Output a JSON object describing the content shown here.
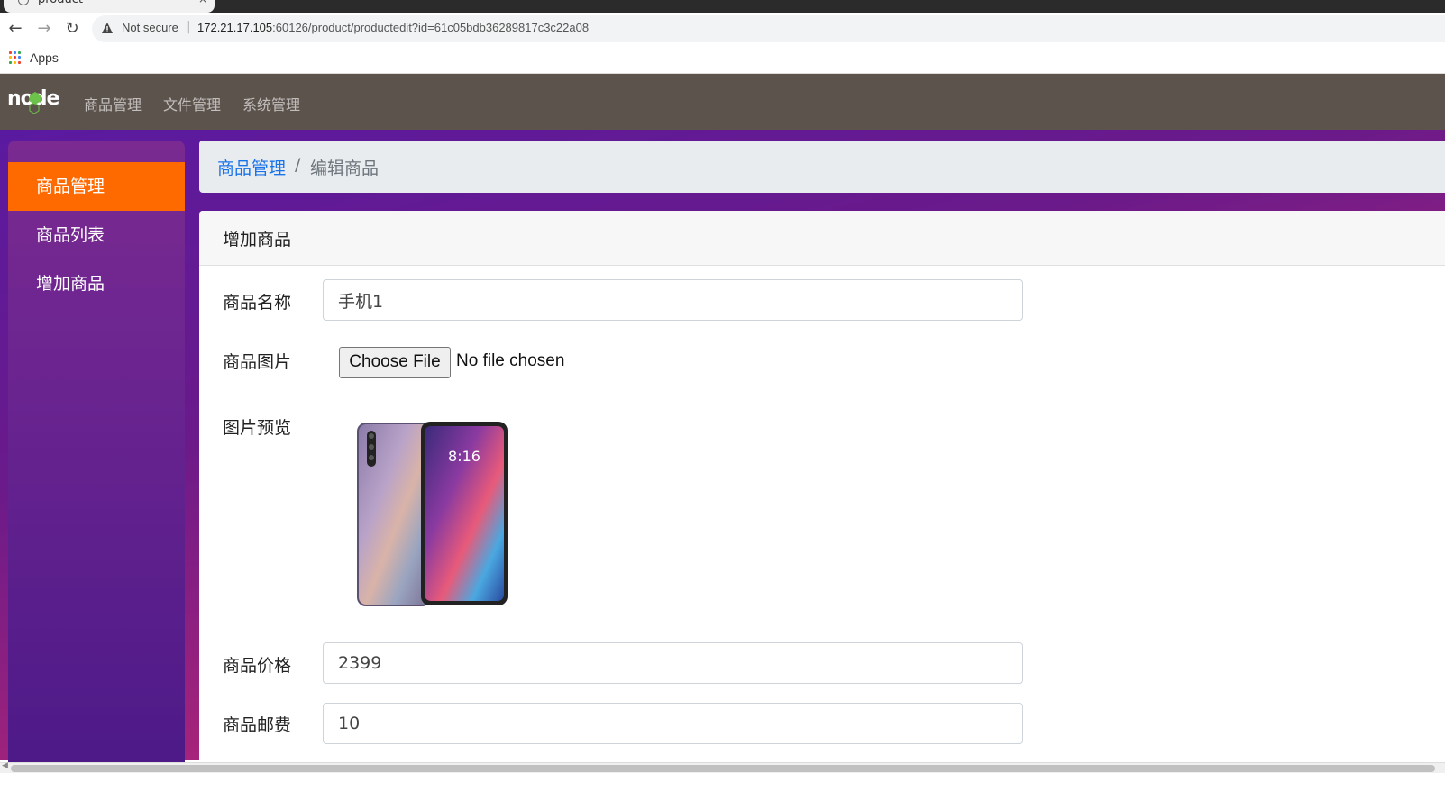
{
  "browser": {
    "tab_title": "product",
    "tab_close": "×",
    "not_secure": "Not secure",
    "url_host": "172.21.17.105",
    "url_rest": ":60126/product/productedit?id=61c05bdb36289817c3c22a08",
    "bookmark_apps": "Apps"
  },
  "navbar": {
    "logo_text": "node",
    "links": [
      "商品管理",
      "文件管理",
      "系统管理"
    ]
  },
  "sidebar": {
    "items": [
      {
        "label": "商品管理",
        "active": true
      },
      {
        "label": "商品列表",
        "active": false
      },
      {
        "label": "增加商品",
        "active": false
      }
    ]
  },
  "breadcrumb": {
    "parent": "商品管理",
    "separator": "/",
    "current": "编辑商品"
  },
  "form": {
    "card_title": "增加商品",
    "name_label": "商品名称",
    "name_value": "手机1",
    "image_label": "商品图片",
    "choose_file_label": "Choose File",
    "file_status": "No file chosen",
    "preview_label": "图片预览",
    "preview_clock": "8:16",
    "price_label": "商品价格",
    "price_value": "2399",
    "shipping_label": "商品邮费",
    "shipping_value": "10"
  },
  "colors": {
    "navbar_bg": "#5d534d",
    "sidebar_active": "#ff6a00",
    "link_blue": "#1a73e8"
  }
}
